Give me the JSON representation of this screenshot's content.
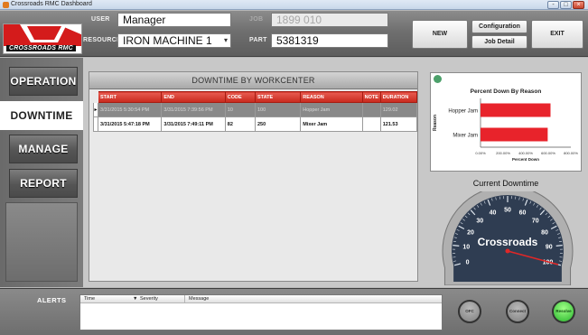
{
  "window": {
    "title": "Crossroads RMC Dashboard",
    "minimize": "-",
    "maximize": "□",
    "close": "×"
  },
  "header": {
    "logo_text": "CROSSROADS RMC",
    "user_label": "USER",
    "user_value": "Manager",
    "job_label": "JOB",
    "job_value": "1899 010",
    "resource_label": "RESOURCE",
    "resource_value": "IRON MACHINE 1",
    "part_label": "PART",
    "part_value": "5381319",
    "new_button": "NEW",
    "configuration_button": "Configuration",
    "job_detail_button": "Job Detail",
    "exit_button": "EXIT"
  },
  "nav": {
    "items": [
      {
        "label": "OPERATION"
      },
      {
        "label": "DOWNTIME"
      },
      {
        "label": "MANAGE"
      },
      {
        "label": "REPORT"
      }
    ],
    "active_index": 1
  },
  "downtime": {
    "title": "DOWNTIME BY WORKCENTER",
    "columns": [
      "START",
      "END",
      "CODE",
      "STATE",
      "REASON",
      "NOTE",
      "DURATION"
    ],
    "rows": [
      {
        "start": "3/31/2015 5:30:54 PM",
        "end": "3/31/2015 7:39:56 PM",
        "code": "10",
        "state": "100",
        "reason": "Hopper Jam",
        "note": "",
        "duration": "129.02"
      },
      {
        "start": "3/31/2015 5:47:18 PM",
        "end": "3/31/2015 7:49:11 PM",
        "code": "82",
        "state": "250",
        "reason": "Mixer Jam",
        "note": "",
        "duration": "121.53"
      }
    ]
  },
  "chart_data": {
    "type": "bar",
    "orientation": "horizontal",
    "title": "Percent Down By Reason",
    "xlabel": "Percent Down",
    "ylabel": "Reason",
    "categories": [
      "Hopper Jam",
      "Mixer Jam"
    ],
    "values": [
      620,
      595
    ],
    "xlim": [
      0,
      800
    ],
    "xticks": [
      "0.00%",
      "200.00%",
      "400.00%",
      "600.00%",
      "800.00%"
    ],
    "bar_color": "#e8232b",
    "legend": "none"
  },
  "gauge": {
    "title": "Current Downtime",
    "label": "Crossroads",
    "ticks": [
      "0",
      "10",
      "20",
      "30",
      "40",
      "50",
      "60",
      "70",
      "80",
      "90",
      "100"
    ],
    "min": 0,
    "max": 100,
    "value": 100,
    "needle_color": "#e02727"
  },
  "alerts": {
    "label": "ALERTS",
    "columns": [
      "Time",
      "Severity",
      "Message"
    ],
    "severity_filter_icon": "▼",
    "buttons": {
      "off": "OFC",
      "connect": "Connect",
      "resolve": "Resolve"
    }
  },
  "colors": {
    "header_red": "#d3342a",
    "active_green": "#27b52b"
  }
}
